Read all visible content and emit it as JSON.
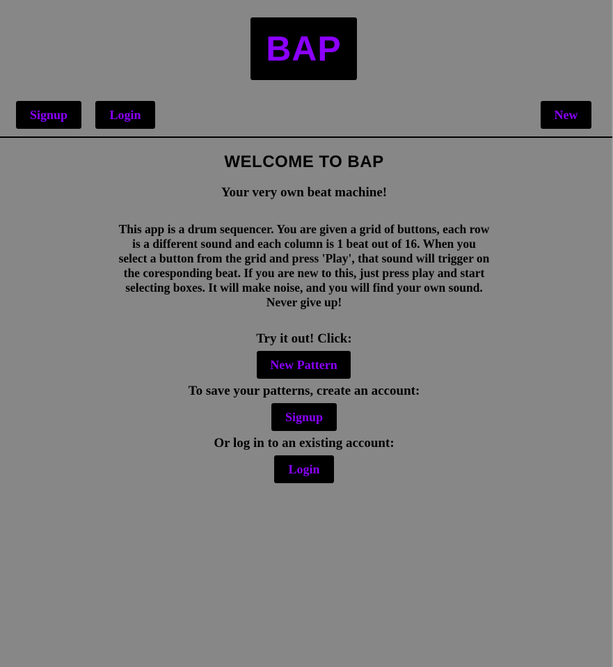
{
  "header": {
    "logo_text": "BAP",
    "nav": {
      "signup_label": "Signup",
      "login_label": "Login",
      "new_label": "New"
    }
  },
  "main": {
    "heading": "WELCOME TO BAP",
    "tagline": "Your very own beat machine!",
    "description": "This app is a drum sequencer. You are given a grid of buttons, each row is a different sound and each column is 1 beat out of 16. When you select a button from the grid and press 'Play', that sound will trigger on the coresponding beat. If you are new to this, just press play and start selecting boxes. It will make noise, and you will find your own sound. Never give up!",
    "try_prompt": "Try it out! Click:",
    "new_pattern_label": "New Pattern",
    "save_prompt": "To save your patterns, create an account:",
    "signup_label": "Signup",
    "login_prompt": "Or log in to an existing account:",
    "login_label": "Login"
  },
  "colors": {
    "background": "#878787",
    "button_bg": "#000000",
    "accent": "#8b00ff",
    "text": "#000000"
  }
}
